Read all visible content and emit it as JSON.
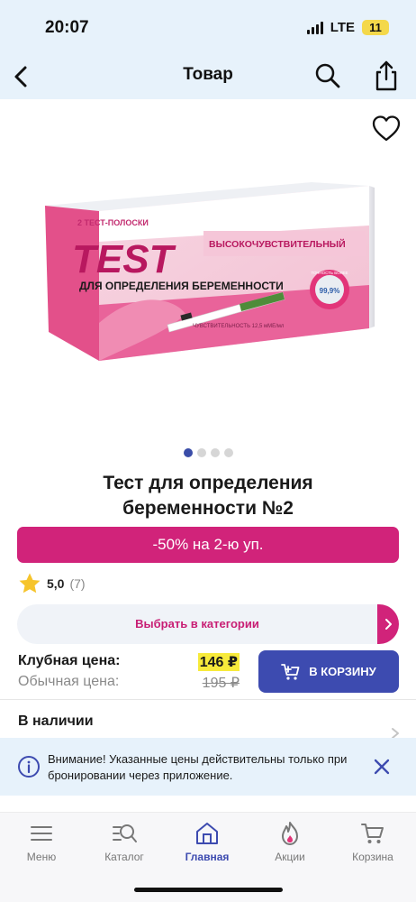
{
  "status_bar": {
    "time": "20:07",
    "network": "LTE",
    "battery": "11",
    "battery_color": "#f4d84a"
  },
  "header": {
    "title": "Товар",
    "icons": [
      "back-icon",
      "search-icon",
      "share-icon"
    ]
  },
  "product": {
    "favorite_icon": "heart-outline-icon",
    "image_text": {
      "strips": "2 ТЕСТ-ПОЛОСКИ",
      "brand": "TEST",
      "purpose": "ДЛЯ ОПРЕДЕЛЕНИЯ БЕРЕМЕННОСТИ",
      "badge": "ВЫСОКОЧУВСТВИТЕЛЬНЫЙ",
      "accuracy_caption": "ТОЧНОСТЬ БОЛЕЕ",
      "accuracy": "99,9%",
      "sensitivity": "ЧУВСТВИТЕЛЬНОСТЬ 12,5 мМЕ/мл"
    },
    "carousel": {
      "count": 4,
      "active": 0
    },
    "title": "Тест для определения беременности №2",
    "promo": "-50% на 2-ю уп.",
    "rating": {
      "value": "5,0",
      "count": "(7)"
    },
    "category_label": "Выбрать в категории",
    "club_price_label": "Клубная цена:",
    "club_price": "146 ₽",
    "regular_price_label": "Обычная цена:",
    "regular_price": "195 ₽",
    "cart_button_label": "В КОРЗИНУ",
    "availability": "В наличии"
  },
  "notice": {
    "text": "Внимание! Указанные цены действительны только при бронировании через приложение."
  },
  "tabs": [
    {
      "label": "Меню",
      "icon": "menu-icon",
      "active": false
    },
    {
      "label": "Каталог",
      "icon": "catalog-search-icon",
      "active": false
    },
    {
      "label": "Главная",
      "icon": "home-icon",
      "active": true
    },
    {
      "label": "Акции",
      "icon": "flame-icon",
      "active": false
    },
    {
      "label": "Корзина",
      "icon": "cart-icon",
      "active": false
    }
  ],
  "colors": {
    "accent_pink": "#d1237a",
    "accent_blue": "#3d4bb0",
    "price_highlight": "#f7ea3b",
    "header_bg": "#e7f2fb"
  }
}
